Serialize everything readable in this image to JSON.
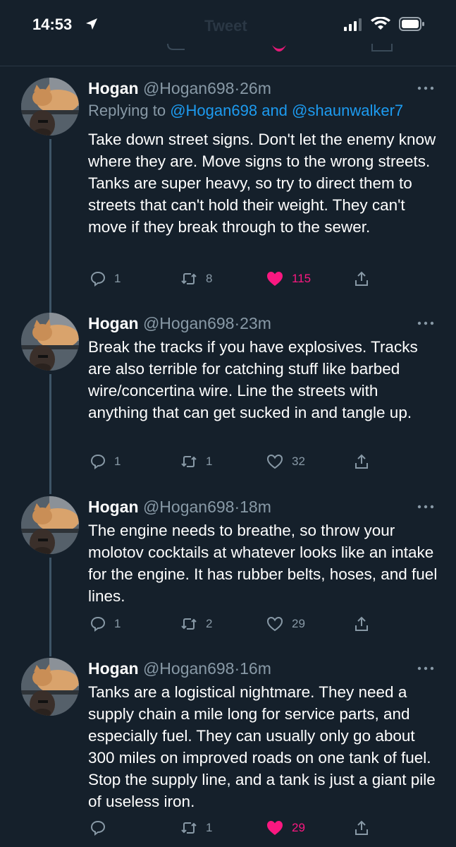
{
  "status_bar": {
    "time": "14:53",
    "background_title": "Tweet"
  },
  "colors": {
    "background": "#15202b",
    "text": "#ffffff",
    "secondary": "#8899a6",
    "accent": "#1d9bf0",
    "like": "#f91880"
  },
  "tweets": [
    {
      "name": "Hogan",
      "handle": "@Hogan698",
      "separator": "·",
      "time": "26m",
      "reply_prefix": "Replying to",
      "reply_mention_1": "@Hogan698",
      "reply_and": "and",
      "reply_mention_2": "@shaunwalker7",
      "text": "Take down street signs. Don't let the enemy know where they are. Move signs to the wrong streets. Tanks are super heavy, so try to direct them to streets that can't hold their weight. They can't move if they break through to the sewer.",
      "replies": "1",
      "retweets": "8",
      "likes": "115",
      "liked": true,
      "avatar_icon": "profile-photo-cat-icon"
    },
    {
      "name": "Hogan",
      "handle": "@Hogan698",
      "separator": "·",
      "time": "23m",
      "text": "Break the tracks if you have explosives. Tracks are also terrible for catching stuff like barbed wire/concertina wire. Line the streets with anything that can get sucked in and tangle up.",
      "replies": "1",
      "retweets": "1",
      "likes": "32",
      "liked": false,
      "avatar_icon": "profile-photo-cat-icon"
    },
    {
      "name": "Hogan",
      "handle": "@Hogan698",
      "separator": "·",
      "time": "18m",
      "text": "The engine needs to breathe, so throw your molotov cocktails at whatever looks like an intake for the engine. It has rubber belts, hoses, and fuel lines.",
      "replies": "1",
      "retweets": "2",
      "likes": "29",
      "liked": false,
      "avatar_icon": "profile-photo-cat-icon"
    },
    {
      "name": "Hogan",
      "handle": "@Hogan698",
      "separator": "·",
      "time": "16m",
      "text": "Tanks are a logistical nightmare. They need a supply chain a mile long for service parts, and especially fuel. They can usually only go about 300 miles on improved roads on one tank of fuel. Stop the supply line, and a tank is just a giant pile of useless iron.",
      "replies": "",
      "retweets": "1",
      "likes": "29",
      "liked": true,
      "avatar_icon": "profile-photo-cat-icon"
    }
  ]
}
